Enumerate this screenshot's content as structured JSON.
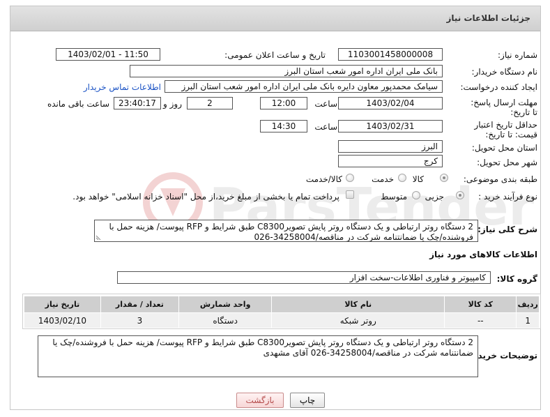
{
  "header": {
    "title": "جزئیات اطلاعات نیاز"
  },
  "labels": {
    "need_number": "شماره نیاز:",
    "announce_datetime": "تاریخ و ساعت اعلان عمومی:",
    "buyer_org": "نام دستگاه خریدار:",
    "requester": "ایجاد کننده درخواست:",
    "reply_deadline": "مهلت ارسال پاسخ: تا تاریخ:",
    "price_validity": "حداقل تاریخ اعتبار قیمت: تا تاریخ:",
    "time": "ساعت",
    "day_and": "روز و",
    "hours_remaining": "ساعت باقی مانده",
    "province": "استان محل تحویل:",
    "city": "شهر محل تحویل:",
    "category": "طبقه بندی موضوعی:",
    "purchase_type": "نوع فرآیند خرید :",
    "general_desc": "شرح کلی نیاز:",
    "goods_info": "اطلاعات کالاهای مورد نیاز",
    "goods_group": "گروه کالا:",
    "buyer_notes": "توضیحات خریدار:"
  },
  "values": {
    "need_number": "1103001458000008",
    "announce_datetime": "1403/02/01 - 11:50",
    "buyer_org": "بانک ملی ایران اداره امور شعب استان البرز",
    "requester": "سیامک محمدپور معاون دایره  بانک ملی ایران اداره امور شعب استان البرز",
    "contact_link": "اطلاعات تماس خریدار",
    "reply_date": "1403/02/04",
    "reply_time": "12:00",
    "days": "2",
    "countdown": "23:40:17",
    "validity_date": "1403/02/31",
    "validity_time": "14:30",
    "province": "البرز",
    "city": "کرج",
    "goods_group": "کامپیوتر و فناوری اطلاعات-سخت افزار"
  },
  "category_options": [
    {
      "label": "کالا",
      "selected": true
    },
    {
      "label": "خدمت",
      "selected": false
    },
    {
      "label": "کالا/خدمت",
      "selected": false
    }
  ],
  "purchase_options": [
    {
      "label": "جزیی",
      "selected": true
    },
    {
      "label": "متوسط",
      "selected": false
    }
  ],
  "payment_note": "پرداخت تمام یا بخشی از مبلغ خرید،از محل \"اسناد خزانه اسلامی\" خواهد بود.",
  "general_desc_lines": [
    "2 دستگاه روتر ارتباطی و یک دستگاه روتر پایش تصویرC8300 طبق شرایط و RFP پیوست/ هزینه حمل با",
    "فروشنده/چک یا ضمانتنامه شرکت در مناقصه/34258004-026"
  ],
  "table": {
    "headers": [
      "ردیف",
      "کد کالا",
      "نام کالا",
      "واحد شمارش",
      "تعداد / مقدار",
      "تاریخ نیاز"
    ],
    "rows": [
      [
        "1",
        "--",
        "روتر شبکه",
        "دستگاه",
        "3",
        "1403/02/10"
      ]
    ]
  },
  "buyer_notes_lines": [
    "2 دستگاه روتر ارتباطی و یک دستگاه روتر پایش تصویرC8300 طبق شرایط و RFP پیوست/ هزینه حمل با فروشنده/چک یا",
    "ضمانتنامه شرکت در مناقصه/34258004-026 آقای مشهدی"
  ],
  "buttons": {
    "print": "چاپ",
    "back": "بازگشت"
  }
}
